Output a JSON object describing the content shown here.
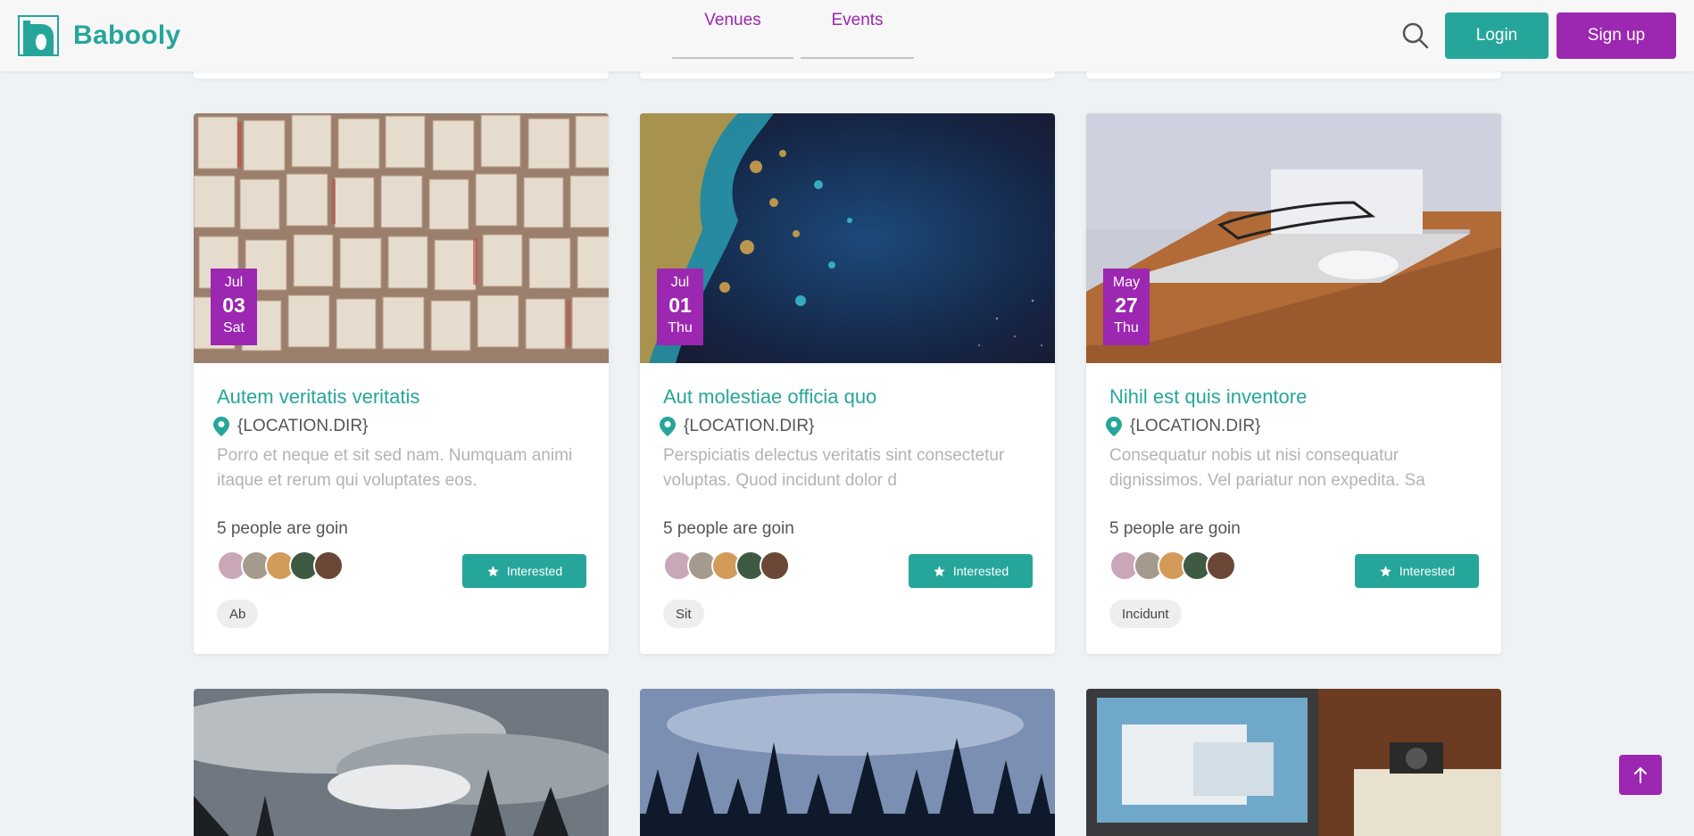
{
  "brand": {
    "name": "Babooly",
    "primary": "#26a69a",
    "accent": "#9c27b0"
  },
  "nav": {
    "venues": "Venues",
    "events": "Events"
  },
  "header": {
    "search_icon": "search-icon",
    "login": "Login",
    "signup": "Sign up"
  },
  "cards": [
    {
      "month": "Jul",
      "day": "03",
      "weekday": "Sat",
      "title": "Autem veritatis veritatis",
      "location": "{LOCATION.DIR}",
      "description": "Porro et neque et sit sed nam. Numquam animi itaque et rerum qui voluptates eos.",
      "going": "5 people are goin",
      "interested": "Interested",
      "tag": "Ab"
    },
    {
      "month": "Jul",
      "day": "01",
      "weekday": "Thu",
      "title": "Aut molestiae officia quo",
      "location": "{LOCATION.DIR}",
      "description": "Perspiciatis delectus veritatis sint consectetur voluptas. Quod incidunt dolor d",
      "going": "5 people are goin",
      "interested": "Interested",
      "tag": "Sit"
    },
    {
      "month": "May",
      "day": "27",
      "weekday": "Thu",
      "title": "Nihil est quis inventore",
      "location": "{LOCATION.DIR}",
      "description": "Consequatur nobis ut nisi consequatur dignissimos. Vel pariatur non expedita. Sa",
      "going": "5 people are goin",
      "interested": "Interested",
      "tag": "Incidunt"
    }
  ],
  "scroll_top_icon": "arrow-up-icon"
}
